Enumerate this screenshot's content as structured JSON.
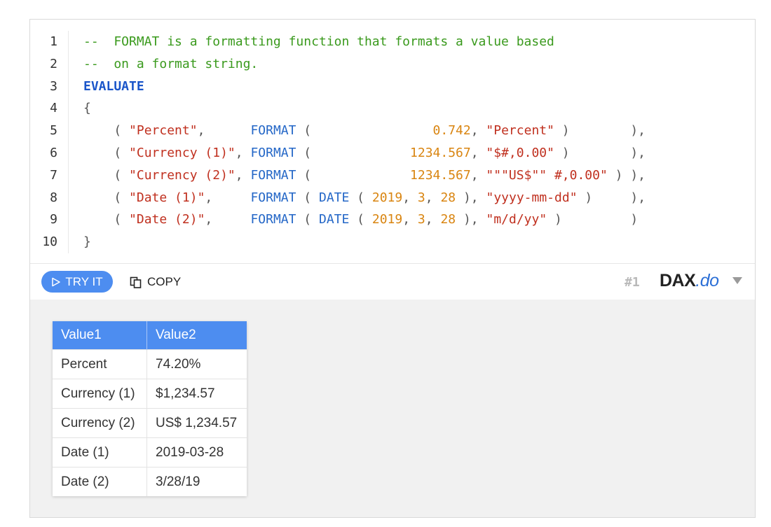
{
  "code": {
    "line_numbers": [
      "1",
      "2",
      "3",
      "4",
      "5",
      "6",
      "7",
      "8",
      "9",
      "10"
    ],
    "lines": [
      [
        {
          "t": "--  FORMAT is a formatting function that formats a value based",
          "c": "cm"
        }
      ],
      [
        {
          "t": "--  on a format string.",
          "c": "cm"
        }
      ],
      [
        {
          "t": "EVALUATE",
          "c": "kw"
        }
      ],
      [
        {
          "t": "{",
          "c": "pu"
        }
      ],
      [
        {
          "t": "    ( ",
          "c": "pu"
        },
        {
          "t": "\"Percent\"",
          "c": "st"
        },
        {
          "t": ",      ",
          "c": "pu"
        },
        {
          "t": "FORMAT",
          "c": "fn"
        },
        {
          "t": " (                ",
          "c": "pu"
        },
        {
          "t": "0.742",
          "c": "nm"
        },
        {
          "t": ", ",
          "c": "pu"
        },
        {
          "t": "\"Percent\"",
          "c": "st"
        },
        {
          "t": " )        ),",
          "c": "pu"
        }
      ],
      [
        {
          "t": "    ( ",
          "c": "pu"
        },
        {
          "t": "\"Currency (1)\"",
          "c": "st"
        },
        {
          "t": ", ",
          "c": "pu"
        },
        {
          "t": "FORMAT",
          "c": "fn"
        },
        {
          "t": " (             ",
          "c": "pu"
        },
        {
          "t": "1234.567",
          "c": "nm"
        },
        {
          "t": ", ",
          "c": "pu"
        },
        {
          "t": "\"$#,0.00\"",
          "c": "st"
        },
        {
          "t": " )        ),",
          "c": "pu"
        }
      ],
      [
        {
          "t": "    ( ",
          "c": "pu"
        },
        {
          "t": "\"Currency (2)\"",
          "c": "st"
        },
        {
          "t": ", ",
          "c": "pu"
        },
        {
          "t": "FORMAT",
          "c": "fn"
        },
        {
          "t": " (             ",
          "c": "pu"
        },
        {
          "t": "1234.567",
          "c": "nm"
        },
        {
          "t": ", ",
          "c": "pu"
        },
        {
          "t": "\"\"\"US$\"\" #,0.00\"",
          "c": "st"
        },
        {
          "t": " ) ),",
          "c": "pu"
        }
      ],
      [
        {
          "t": "    ( ",
          "c": "pu"
        },
        {
          "t": "\"Date (1)\"",
          "c": "st"
        },
        {
          "t": ",     ",
          "c": "pu"
        },
        {
          "t": "FORMAT",
          "c": "fn"
        },
        {
          "t": " ( ",
          "c": "pu"
        },
        {
          "t": "DATE",
          "c": "fn"
        },
        {
          "t": " ( ",
          "c": "pu"
        },
        {
          "t": "2019",
          "c": "nm"
        },
        {
          "t": ", ",
          "c": "pu"
        },
        {
          "t": "3",
          "c": "nm"
        },
        {
          "t": ", ",
          "c": "pu"
        },
        {
          "t": "28",
          "c": "nm"
        },
        {
          "t": " ), ",
          "c": "pu"
        },
        {
          "t": "\"yyyy-mm-dd\"",
          "c": "st"
        },
        {
          "t": " )     ),",
          "c": "pu"
        }
      ],
      [
        {
          "t": "    ( ",
          "c": "pu"
        },
        {
          "t": "\"Date (2)\"",
          "c": "st"
        },
        {
          "t": ",     ",
          "c": "pu"
        },
        {
          "t": "FORMAT",
          "c": "fn"
        },
        {
          "t": " ( ",
          "c": "pu"
        },
        {
          "t": "DATE",
          "c": "fn"
        },
        {
          "t": " ( ",
          "c": "pu"
        },
        {
          "t": "2019",
          "c": "nm"
        },
        {
          "t": ", ",
          "c": "pu"
        },
        {
          "t": "3",
          "c": "nm"
        },
        {
          "t": ", ",
          "c": "pu"
        },
        {
          "t": "28",
          "c": "nm"
        },
        {
          "t": " ), ",
          "c": "pu"
        },
        {
          "t": "\"m/d/yy\"",
          "c": "st"
        },
        {
          "t": " )         )",
          "c": "pu"
        }
      ],
      [
        {
          "t": "}",
          "c": "pu"
        }
      ]
    ]
  },
  "toolbar": {
    "try_label": "TRY IT",
    "copy_label": "COPY",
    "query_number": "#1",
    "brand_main": "DAX",
    "brand_suffix": ".do"
  },
  "results": {
    "columns": [
      "Value1",
      "Value2"
    ],
    "rows": [
      [
        "Percent",
        "74.20%"
      ],
      [
        "Currency (1)",
        "$1,234.57"
      ],
      [
        "Currency (2)",
        "US$ 1,234.57"
      ],
      [
        "Date (1)",
        "2019-03-28"
      ],
      [
        "Date (2)",
        "3/28/19"
      ]
    ]
  },
  "colors": {
    "accent": "#4d8df0",
    "comment": "#3a9a1d",
    "keyword": "#1a55c9",
    "string": "#c0301f",
    "number": "#d98511"
  },
  "icons": {
    "try": "play-triangle-outline-icon",
    "copy": "copy-icon",
    "menu": "caret-down-icon"
  }
}
